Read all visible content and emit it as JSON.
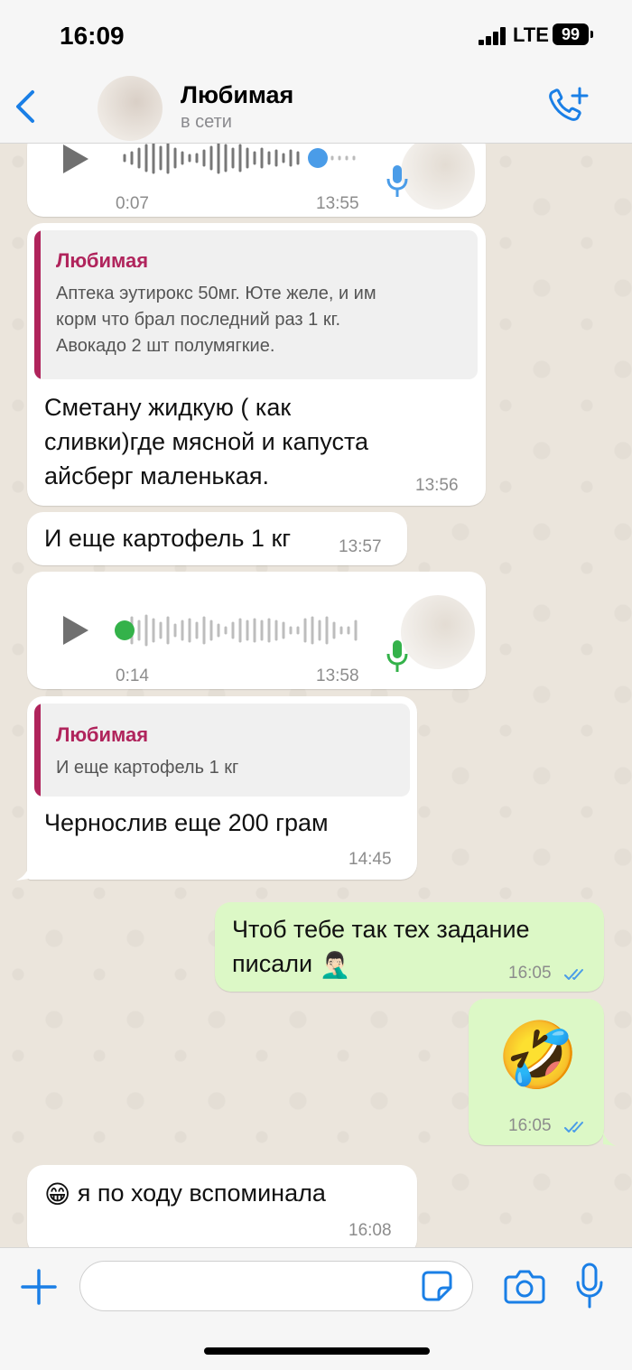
{
  "status_bar": {
    "time": "16:09",
    "network": "LTE",
    "battery": "99"
  },
  "header": {
    "back_icon": "chevron-left-icon",
    "contact_name": "Любимая",
    "contact_status": "в сети",
    "call_icon": "add-call-icon"
  },
  "colors": {
    "accent": "#1a7fe6",
    "quote": "#b0245c",
    "outgoing_bubble": "#dcf8c6",
    "incoming_bubble": "#ffffff",
    "voice_played": "#4a9ce8",
    "voice_unplayed": "#34b24a"
  },
  "messages": [
    {
      "type": "voice",
      "duration": "0:07",
      "time": "13:55"
    },
    {
      "type": "reply",
      "quote_author": "Любимая",
      "quote_lines": [
        "Аптека эутирокс 50мг. Юте желе, и им",
        "корм что брал последний раз 1 кг.",
        "Авокадо 2 шт полумягкие."
      ],
      "text_lines": [
        "Сметану жидкую ( как",
        "сливки)где мясной и капуста",
        "айсберг маленькая."
      ],
      "time": "13:56"
    },
    {
      "type": "text",
      "text": "И еще картофель 1 кг",
      "time": "13:57"
    },
    {
      "type": "voice",
      "duration": "0:14",
      "time": "13:58"
    },
    {
      "type": "reply",
      "quote_author": "Любимая",
      "quote_text": "И еще картофель 1 кг",
      "text": "Чернослив еще 200 грам",
      "time": "14:45"
    },
    {
      "type": "outgoing",
      "text_lines": [
        "Чтоб тебе так тех задание",
        "писали"
      ],
      "emoji": "🤦🏻‍♂️",
      "time": "16:05",
      "status_icon": "double-check-icon"
    },
    {
      "type": "outgoing-emoji",
      "emoji": "🤣",
      "time": "16:05",
      "status_icon": "double-check-icon"
    },
    {
      "type": "text",
      "emoji": "😁",
      "text": "я по ходу вспоминала",
      "time": "16:08"
    }
  ],
  "input_bar": {
    "placeholder": "",
    "value": "",
    "icons": [
      "plus-icon",
      "sticker-icon",
      "camera-icon",
      "microphone-icon"
    ]
  }
}
